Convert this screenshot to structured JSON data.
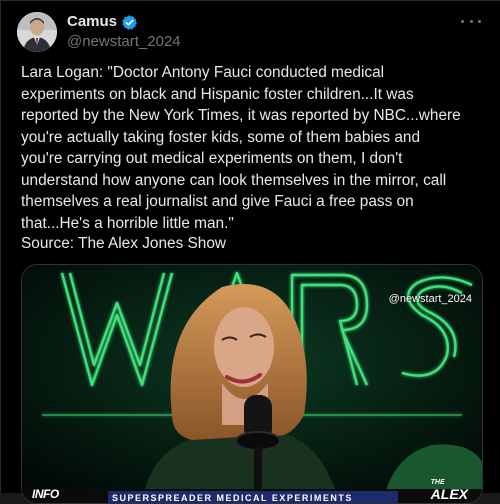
{
  "author": {
    "display_name": "Camus",
    "handle": "@newstart_2024",
    "verified": true,
    "verified_color": "#1d9bf0"
  },
  "tweet": {
    "text": "Lara Logan: \"Doctor Antony Fauci conducted medical\nexperiments on black and Hispanic foster children...It was\nreported by the New York Times, it was reported by NBC...where\nyou're actually taking foster kids, some of them babies and\nyou're carrying out medical experiments on them, I don't\nunderstand how anyone can look themselves in the mirror, call\nthemselves a real journalist and give Fauci a free pass on\nthat...He's a horrible little man.\"",
    "source": "Source: The Alex Jones Show"
  },
  "media": {
    "watermark": "@newstart_2024",
    "ticker_text": "SUPERSPREADER MEDICAL EXPERIMENTS",
    "left_logo": "INFO",
    "right_logo_the": "THE",
    "right_logo_alex": "ALEX",
    "background_sign": "WARS",
    "neon_color": "#3fe07a"
  },
  "icons": {
    "more": "more-options-icon",
    "verified": "verified-badge-icon"
  }
}
